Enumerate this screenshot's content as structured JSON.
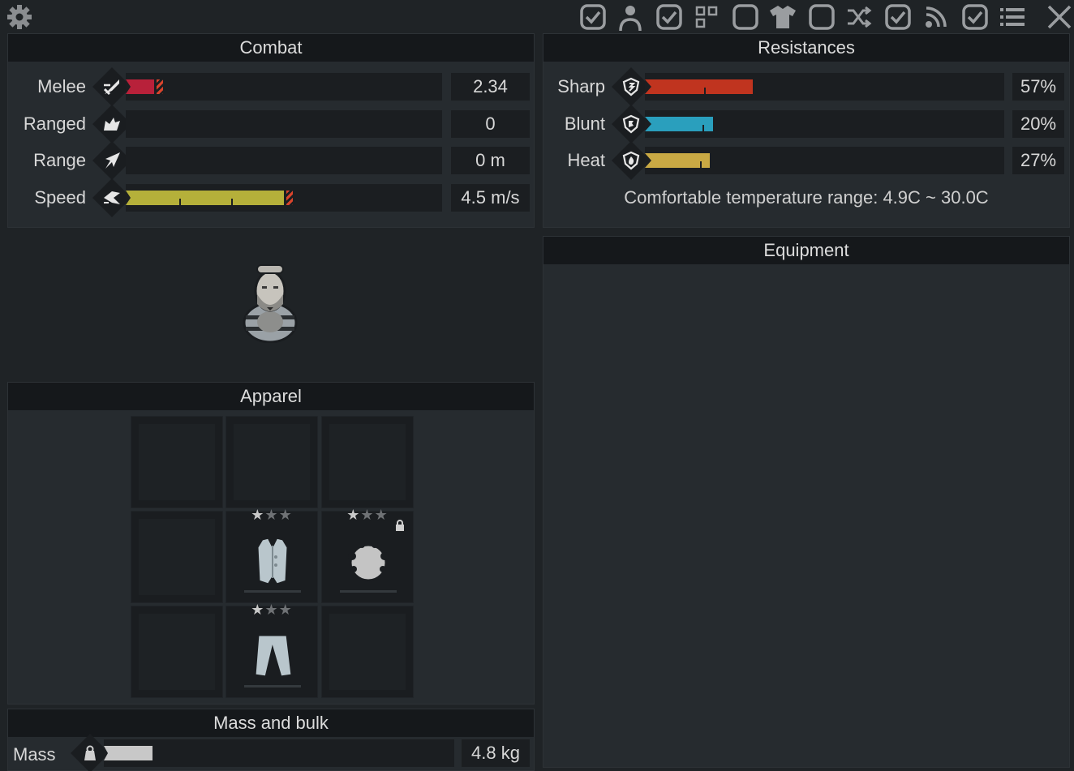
{
  "toolbar": {
    "icons": [
      "gear-icon",
      "checkbox-checked-icon",
      "person-icon",
      "checkbox-checked-icon",
      "grid-icon",
      "checkbox-empty-icon",
      "shirt-icon",
      "checkbox-empty-icon",
      "shuffle-icon",
      "checkbox-checked-icon",
      "feed-icon",
      "checkbox-checked-icon",
      "list-icon",
      "close-icon"
    ]
  },
  "combat": {
    "title": "Combat",
    "rows": [
      {
        "label": "Melee",
        "icon": "sword-icon",
        "value": "2.34",
        "fill": 0.09,
        "color": "#b8213a",
        "overflow": true
      },
      {
        "label": "Ranged",
        "icon": "gun-icon",
        "value": "0",
        "fill": 0,
        "color": "#b8213a",
        "overflow": false
      },
      {
        "label": "Range",
        "icon": "arrow-icon",
        "value": "0 m",
        "fill": 0,
        "color": "#b8213a",
        "overflow": false
      },
      {
        "label": "Speed",
        "icon": "speed-icon",
        "value": "4.5 m/s",
        "fill": 0.5,
        "color": "#b5b03a",
        "overflow": true
      }
    ]
  },
  "resistances": {
    "title": "Resistances",
    "rows": [
      {
        "label": "Sharp",
        "icon": "shield-sharp-icon",
        "value": "57%",
        "fill": 0.3,
        "color": "#c0341f"
      },
      {
        "label": "Blunt",
        "icon": "shield-blunt-icon",
        "value": "20%",
        "fill": 0.19,
        "color": "#2a9fbd"
      },
      {
        "label": "Heat",
        "icon": "shield-heat-icon",
        "value": "27%",
        "fill": 0.18,
        "color": "#c9a944"
      }
    ],
    "comfort_text": "Comfortable temperature range: 4.9C ~ 30.0C"
  },
  "equipment": {
    "title": "Equipment"
  },
  "apparel": {
    "title": "Apparel",
    "slots": [
      {
        "item": null
      },
      {
        "item": null
      },
      {
        "item": null
      },
      {
        "item": null
      },
      {
        "item": "vest-icon",
        "stars": 1,
        "locked": false
      },
      {
        "item": "body-armor-icon",
        "stars": 1,
        "locked": true
      },
      {
        "item": null
      },
      {
        "item": "pants-icon",
        "stars": 1,
        "locked": false
      },
      {
        "item": null
      }
    ]
  },
  "mass": {
    "title": "Mass and bulk",
    "label": "Mass",
    "value": "4.8 kg",
    "fill": 0.14
  }
}
